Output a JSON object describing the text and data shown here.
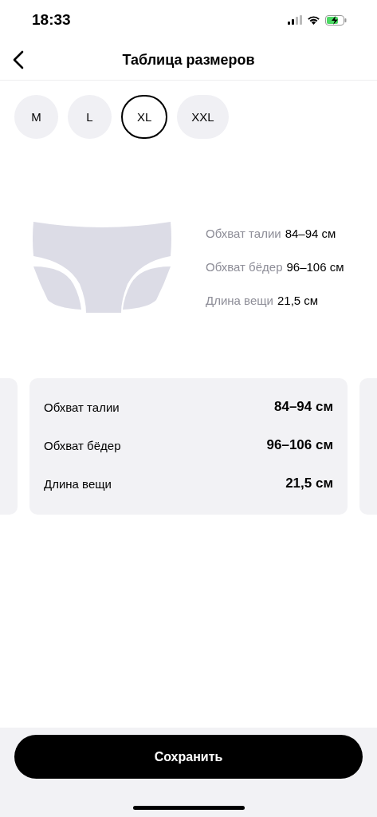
{
  "status_bar": {
    "time": "18:33"
  },
  "header": {
    "title": "Таблица размеров"
  },
  "sizes": [
    {
      "label": "M",
      "selected": false
    },
    {
      "label": "L",
      "selected": false
    },
    {
      "label": "XL",
      "selected": true
    },
    {
      "label": "XXL",
      "selected": false
    }
  ],
  "figure_measurements": [
    {
      "label": "Обхват талии",
      "value": "84–94 см"
    },
    {
      "label": "Обхват бёдер",
      "value": "96–106 см"
    },
    {
      "label": "Длина вещи",
      "value": "21,5 см"
    }
  ],
  "size_card": {
    "rows": [
      {
        "label": "Обхват талии",
        "value": "84–94 см"
      },
      {
        "label": "Обхват бёдер",
        "value": "96–106 см"
      },
      {
        "label": "Длина вещи",
        "value": "21,5 см"
      }
    ]
  },
  "save_button": {
    "label": "Сохранить"
  }
}
